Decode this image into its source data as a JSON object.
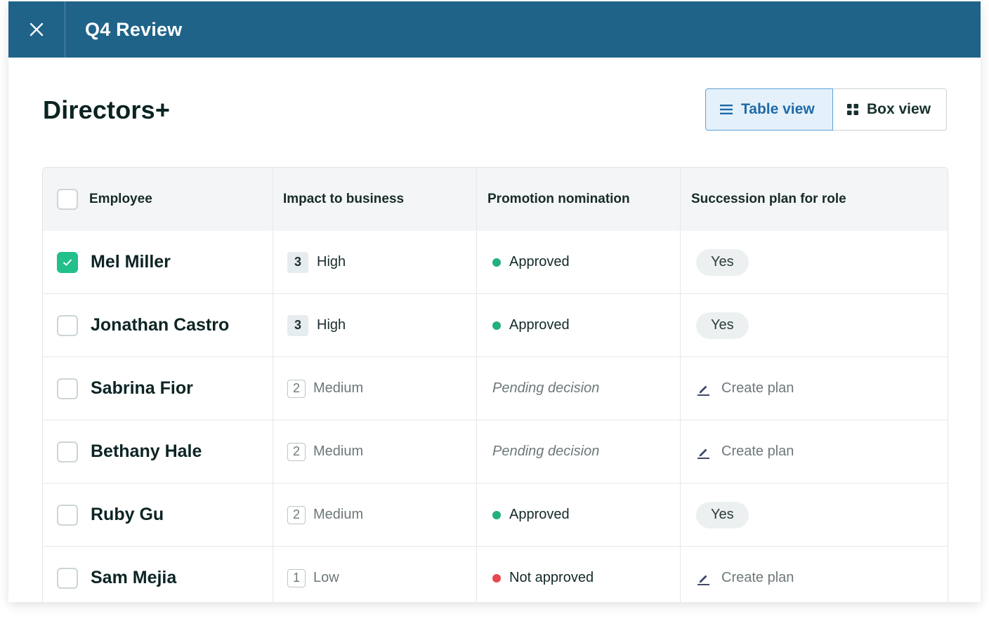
{
  "window": {
    "title": "Q4 Review"
  },
  "page": {
    "heading": "Directors+"
  },
  "view_toggle": {
    "table_label": "Table view",
    "box_label": "Box view",
    "active": "table"
  },
  "table": {
    "columns": [
      "Employee",
      "Impact to business",
      "Promotion nomination",
      "Succession plan for role"
    ],
    "rows": [
      {
        "name": "Mel Miller",
        "checked": true,
        "impact_level": "3",
        "impact_label": "High",
        "nomination": "Approved",
        "nomination_state": "approved",
        "succession": "Yes",
        "succession_type": "pill"
      },
      {
        "name": "Jonathan Castro",
        "checked": false,
        "impact_level": "3",
        "impact_label": "High",
        "nomination": "Approved",
        "nomination_state": "approved",
        "succession": "Yes",
        "succession_type": "pill"
      },
      {
        "name": "Sabrina Fior",
        "checked": false,
        "impact_level": "2",
        "impact_label": "Medium",
        "nomination": "Pending decision",
        "nomination_state": "pending",
        "succession": "Create plan",
        "succession_type": "action"
      },
      {
        "name": "Bethany Hale",
        "checked": false,
        "impact_level": "2",
        "impact_label": "Medium",
        "nomination": "Pending decision",
        "nomination_state": "pending",
        "succession": "Create plan",
        "succession_type": "action"
      },
      {
        "name": "Ruby Gu",
        "checked": false,
        "impact_level": "2",
        "impact_label": "Medium",
        "nomination": "Approved",
        "nomination_state": "approved",
        "succession": "Yes",
        "succession_type": "pill"
      },
      {
        "name": "Sam Mejia",
        "checked": false,
        "impact_level": "1",
        "impact_label": "Low",
        "nomination": "Not approved",
        "nomination_state": "rejected",
        "succession": "Create plan",
        "succession_type": "action"
      }
    ]
  },
  "colors": {
    "topbar": "#1f6389",
    "approved_dot": "#22b07d",
    "rejected_dot": "#e5484d",
    "checkbox_checked": "#22c08a",
    "active_toggle_text": "#1f6aa5"
  },
  "icons": {
    "close": "close-icon",
    "table_view": "list-icon",
    "box_view": "grid-icon",
    "create_plan": "pencil-icon",
    "checked": "check-icon"
  }
}
